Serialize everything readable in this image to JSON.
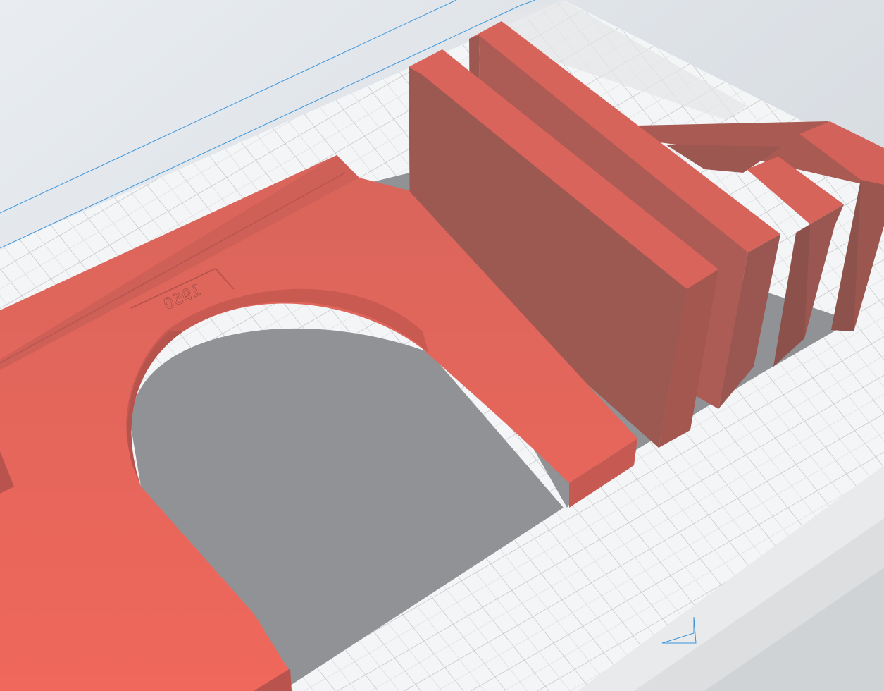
{
  "app": {
    "view": "3d-viewport"
  },
  "scene": {
    "plate_engraving": "1950",
    "colors": {
      "background_top": "#e8ecf0",
      "background_bottom": "#d2d7dd",
      "bed": "#f3f4f5",
      "bed_grid": "#b9bcbf",
      "bed_edge": "#e2e4e6",
      "shadow": "#8f9194",
      "boundary_line": "#3c96dc",
      "model_top": "#e2665c",
      "model_side": "#9d5953",
      "model_side_light": "#b25d55"
    },
    "objects": [
      {
        "name": "tunnel-portal-arch",
        "type": "model"
      },
      {
        "name": "wall-panel",
        "type": "model"
      },
      {
        "name": "wall-panel",
        "type": "model"
      },
      {
        "name": "wall-panel",
        "type": "model"
      },
      {
        "name": "wall-panel",
        "type": "model"
      }
    ]
  }
}
